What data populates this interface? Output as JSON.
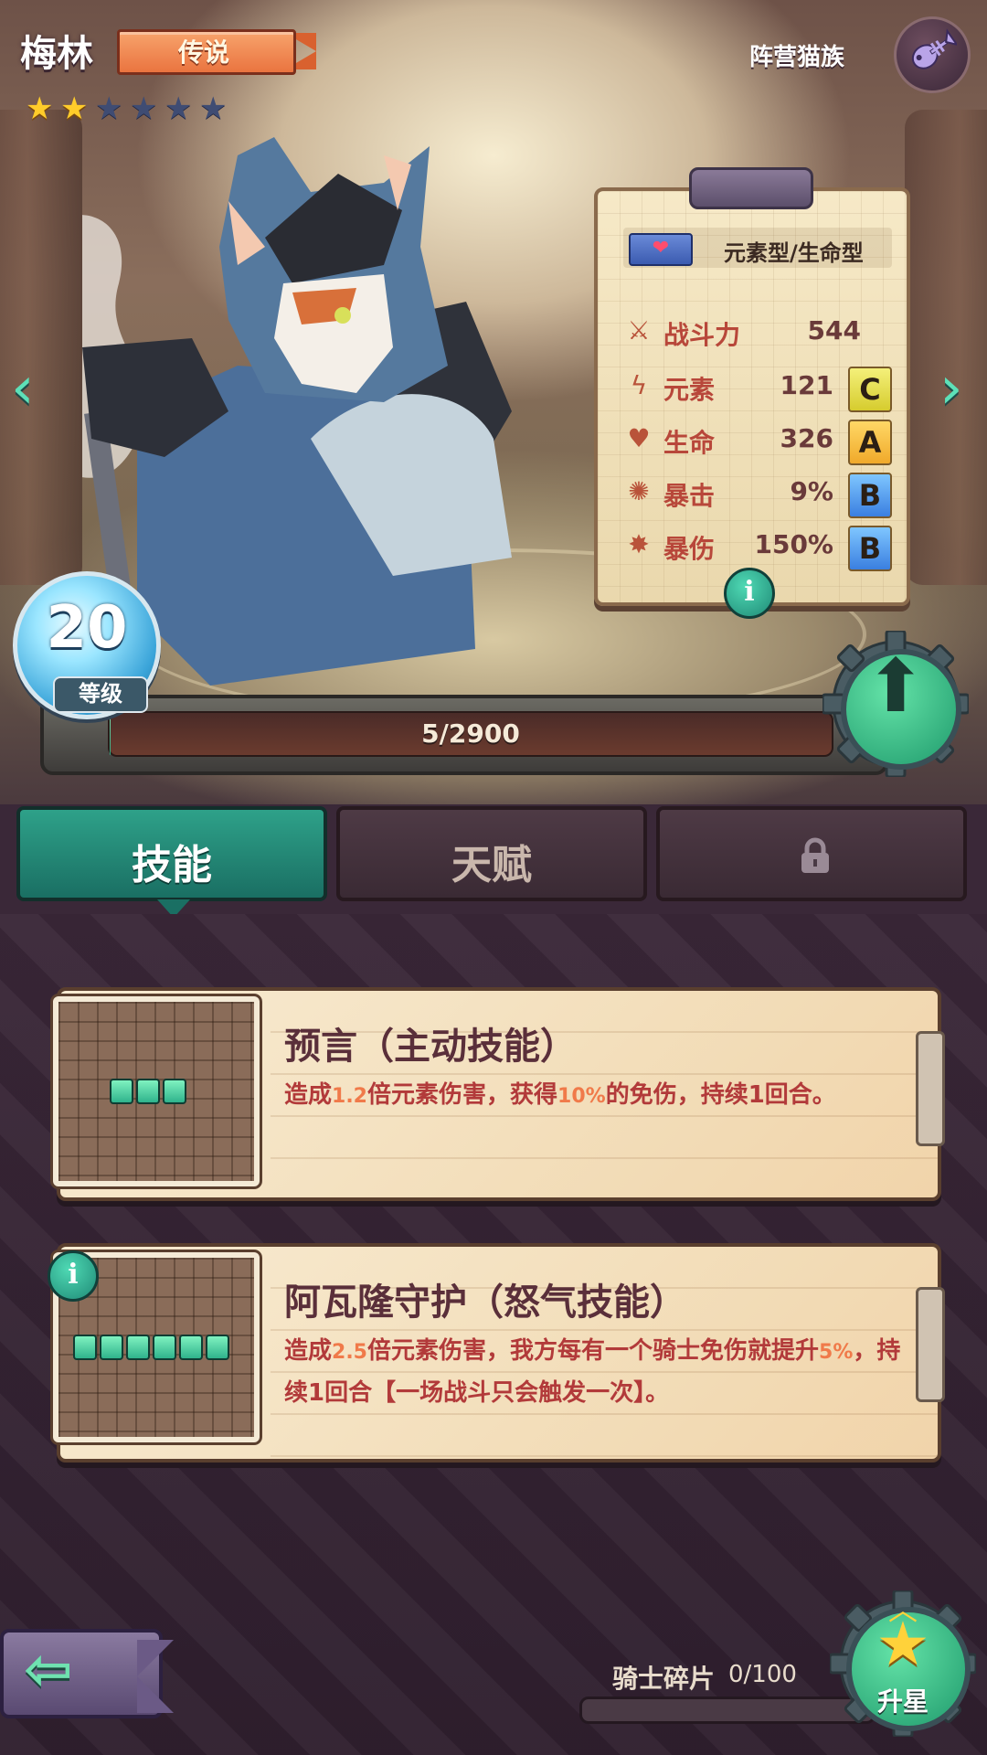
{
  "hero": {
    "name": "梅林",
    "rarity": "传说",
    "stars_total": 6,
    "stars_filled": 2,
    "faction": "阵营猫族",
    "faction_icon": "fish-bone-icon"
  },
  "stats": {
    "type_icon": "broken-heart-icon",
    "type": "元素型/生命型",
    "power": {
      "label": "战斗力",
      "value": "544",
      "icon": "crossed-swords-icon"
    },
    "rows": [
      {
        "label": "元素",
        "value": "121",
        "grade": "C",
        "icon": "lightning-icon"
      },
      {
        "label": "生命",
        "value": "326",
        "grade": "A",
        "icon": "heart-icon"
      },
      {
        "label": "暴击",
        "value": "9%",
        "grade": "B",
        "icon": "crit-burst-icon"
      },
      {
        "label": "暴伤",
        "value": "150%",
        "grade": "B",
        "icon": "blood-splat-icon"
      }
    ],
    "info_glyph": "i"
  },
  "level": {
    "value": "20",
    "label": "等级",
    "exp_text": "5/2900",
    "exp_fraction": 0.0017
  },
  "tabs": [
    {
      "label": "技能",
      "active": true
    },
    {
      "label": "天赋",
      "active": false
    },
    {
      "label": "",
      "locked": true,
      "icon": "lock-icon"
    }
  ],
  "skills": [
    {
      "title": "预言（主动技能）",
      "cells": 3,
      "desc_parts": [
        "造成",
        "1.2",
        "倍元素伤害，获得",
        "10%",
        "的免伤，持续1回合。"
      ]
    },
    {
      "title": "阿瓦隆守护（怒气技能）",
      "cells": 6,
      "desc_parts": [
        "造成",
        "2.5",
        "倍元素伤害，我方每有一个骑士免伤就提升",
        "5%",
        "，持续1回合【一场战斗只会触发一次】。"
      ]
    }
  ],
  "footer": {
    "shard_label": "骑士碎片",
    "shard_count": "0/100",
    "shard_fraction": 0,
    "star_up_label": "升星"
  },
  "colors": {
    "accent": "#2ea189",
    "grade_C": "#e6df4a",
    "grade_A": "#f5bf42",
    "grade_B": "#4c8fe8",
    "desc_red": "#b23a3a",
    "desc_highlight": "#f07a4a"
  }
}
